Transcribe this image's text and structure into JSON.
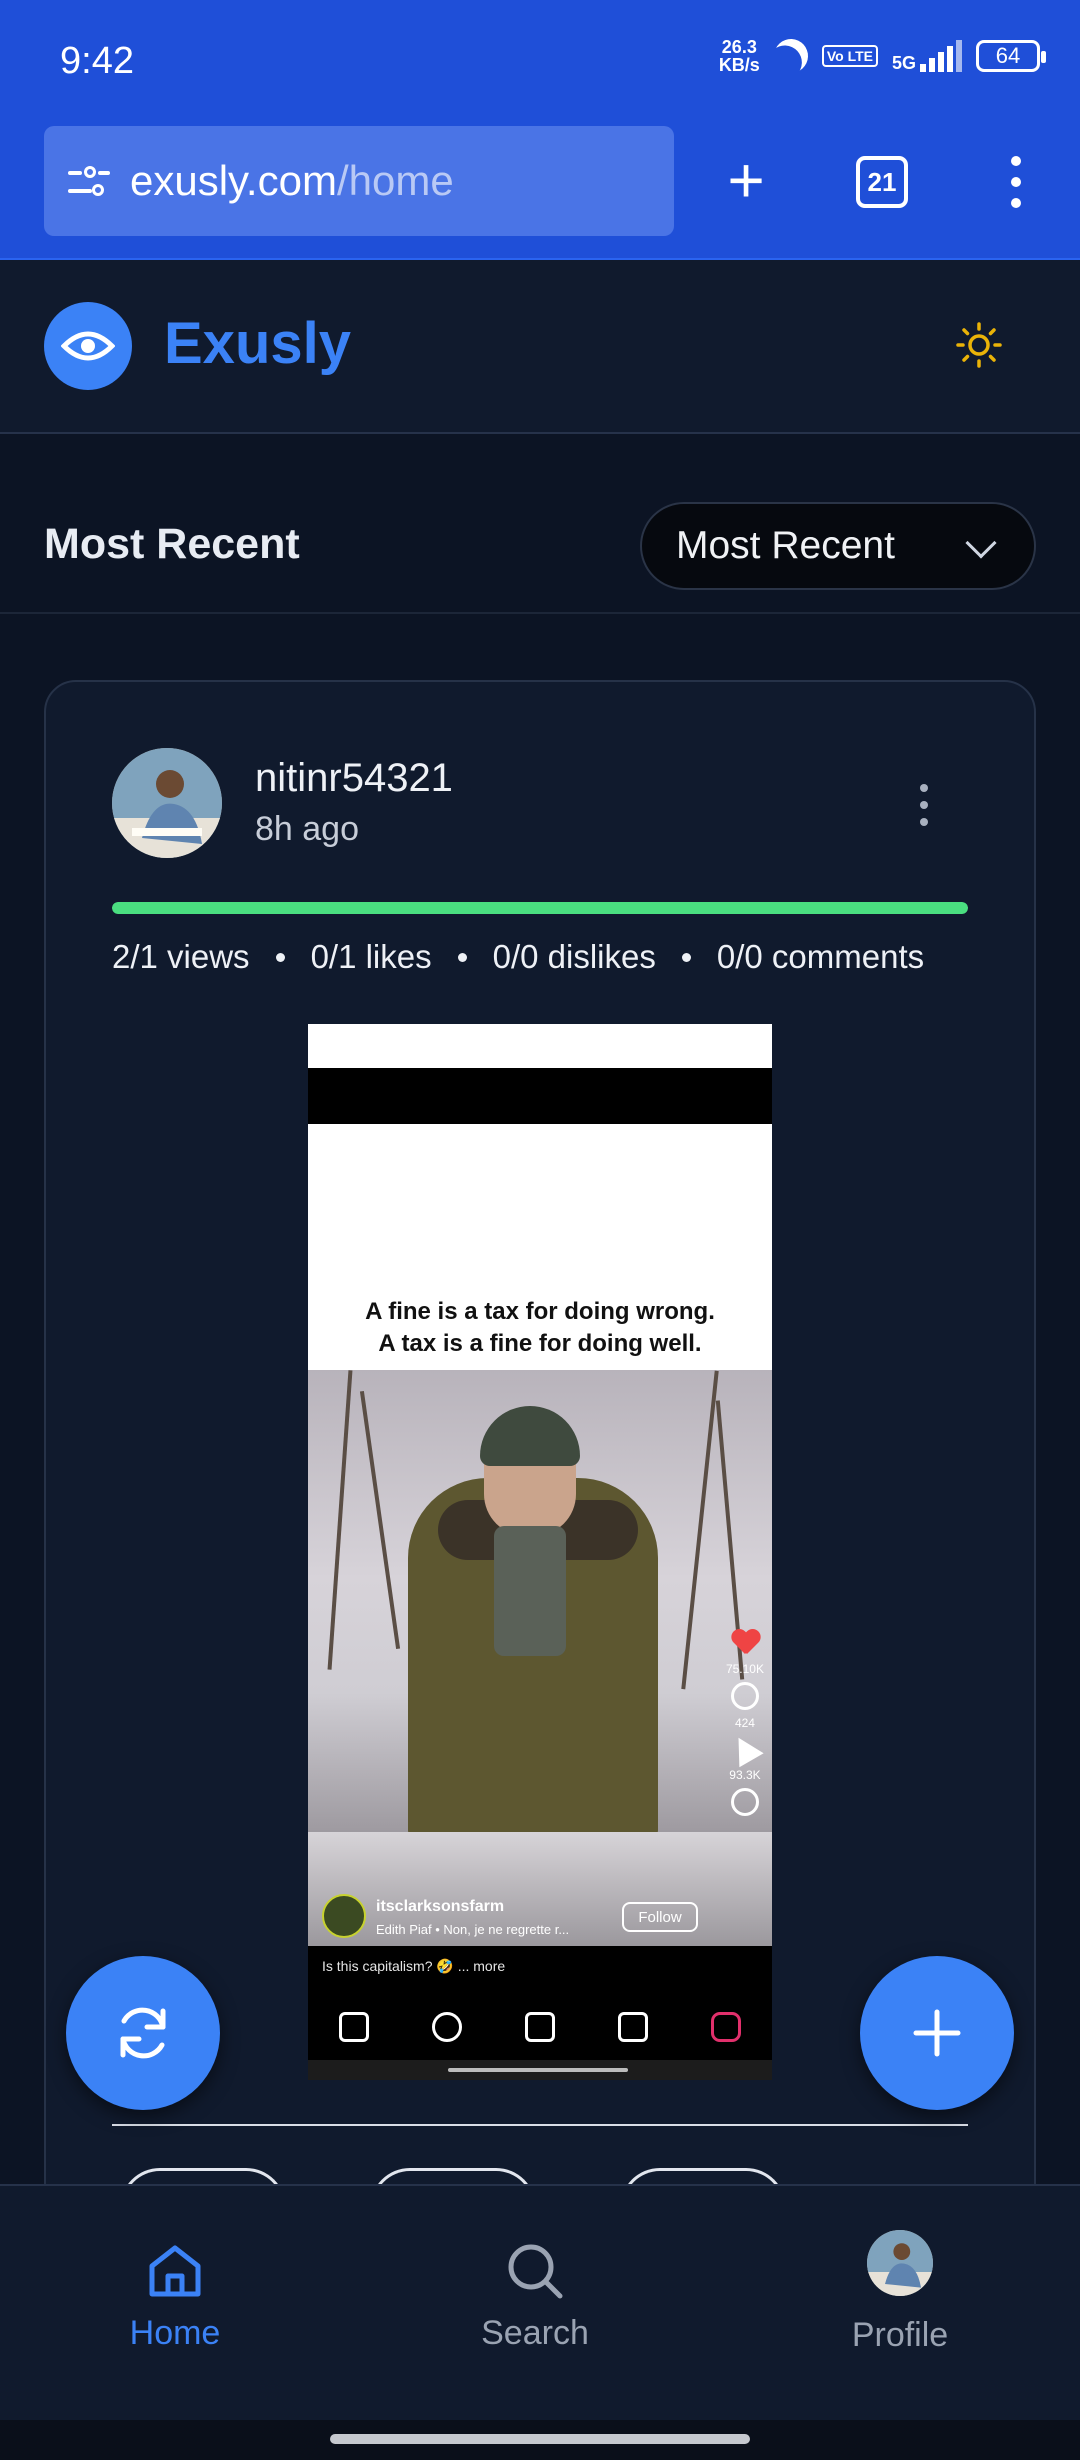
{
  "status_bar": {
    "time": "9:42",
    "net_speed_value": "26.3",
    "net_speed_unit": "KB/s",
    "volte": "Vo LTE",
    "network": "5G",
    "battery": "64"
  },
  "browser": {
    "url_domain": "exusly.com",
    "url_path": "/home",
    "tab_count": "21"
  },
  "app": {
    "brand": "Exusly",
    "accent_color": "#3b82f6"
  },
  "feed": {
    "section_title": "Most Recent",
    "sort_value": "Most Recent"
  },
  "post": {
    "username": "nitinr54321",
    "time_ago": "8h ago",
    "view_progress": 1.0,
    "stats": {
      "views": "2/1 views",
      "likes": "0/1 likes",
      "dislikes": "0/0 dislikes",
      "comments": "0/0 comments"
    },
    "media": {
      "quote_line1": "A fine is a tax for doing wrong.",
      "quote_line2": "A tax is a fine for doing well.",
      "likes": "75.10K",
      "comments": "424",
      "shares": "93.3K",
      "account": "itsclarksonsfarm",
      "song": "Edith Piaf • Non, je ne regrette r...",
      "follow": "Follow",
      "caption": "Is this capitalism? 🤣 ... more"
    }
  },
  "bottom_nav": {
    "home": "Home",
    "search": "Search",
    "profile": "Profile",
    "active_color": "#3b82f6",
    "inactive_color": "#9aa3b2"
  }
}
